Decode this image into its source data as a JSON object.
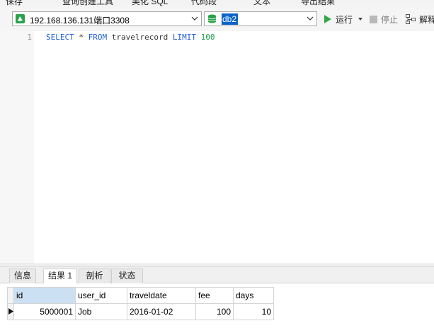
{
  "toolbar": {
    "items": [
      "保存",
      "查询创建工具",
      "美化 SQL",
      "代码段",
      "文本",
      "导出结果"
    ]
  },
  "connection": {
    "label": "192.168.136.131端口3308"
  },
  "database": {
    "label": "db2"
  },
  "actions": {
    "run_label": "运行",
    "stop_label": "停止",
    "explain_label": "解释"
  },
  "editor": {
    "line_number": "1",
    "sql": {
      "select": "SELECT",
      "star": " * ",
      "from": "FROM",
      "table": " travelrecord ",
      "limit": "LIMIT",
      "space": " ",
      "count": "100"
    }
  },
  "tabs": [
    "信息",
    "结果 1",
    "剖析",
    "状态"
  ],
  "result": {
    "columns": [
      "id",
      "user_id",
      "traveldate",
      "fee",
      "days"
    ],
    "rows": [
      [
        "5000001",
        "Job",
        "2016-01-02",
        "100",
        "10"
      ]
    ]
  },
  "colors": {
    "keyword": "#1f5fd6",
    "number": "#1c9a4a",
    "selection": "#0a64c8",
    "run": "#2ea84a"
  }
}
